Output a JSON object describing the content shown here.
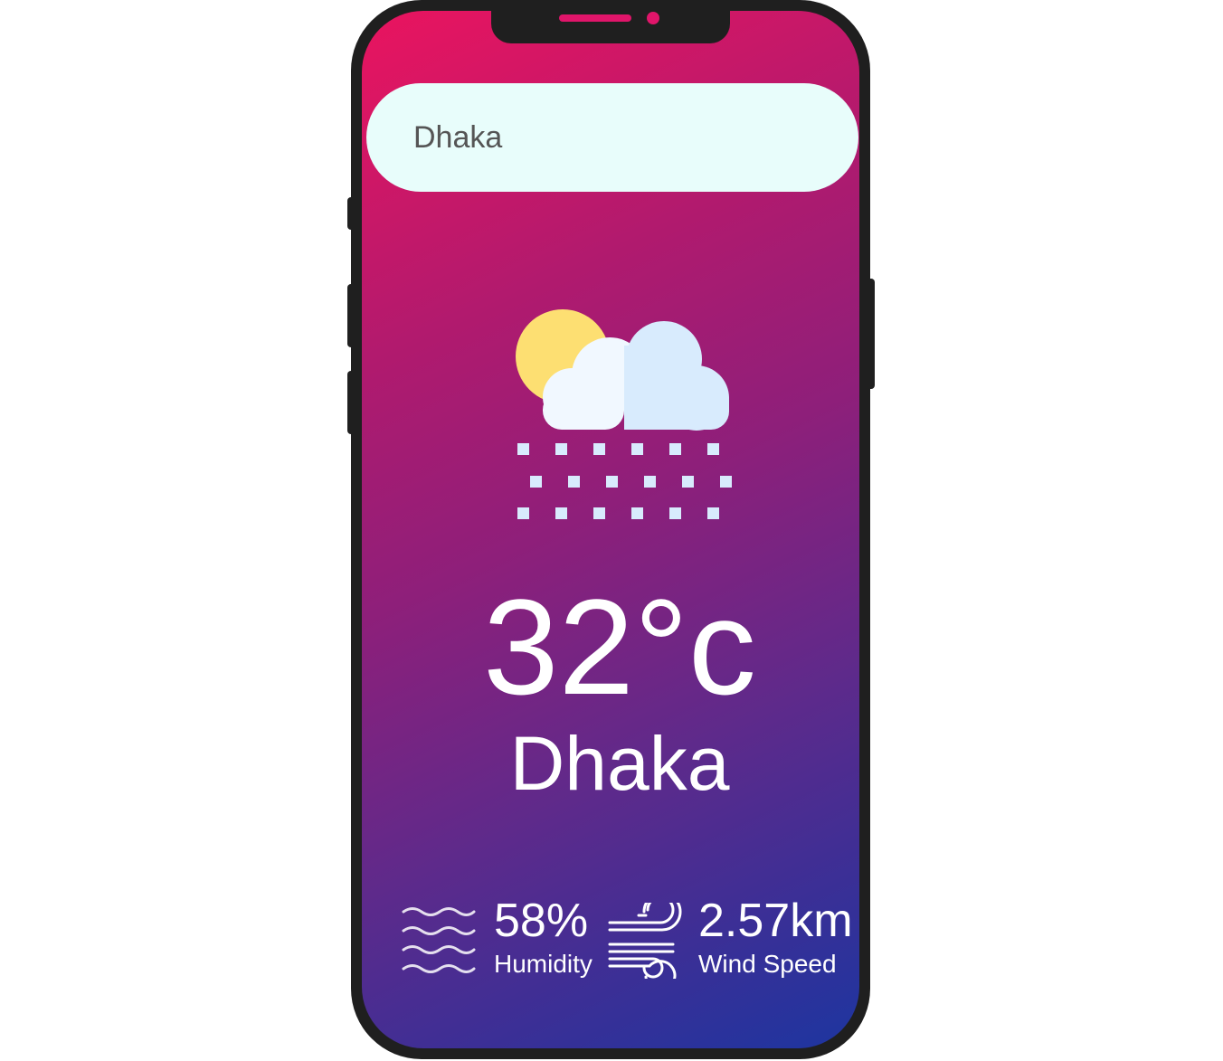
{
  "search": {
    "value": "Dhaka"
  },
  "weather": {
    "icon": "sun-cloud-snow-icon",
    "temperature": "32°c",
    "city": "Dhaka"
  },
  "humidity": {
    "icon": "humidity-waves-icon",
    "value": "58%",
    "label": "Humidity"
  },
  "wind": {
    "icon": "wind-icon",
    "value": "2.57km",
    "label": "Wind Speed"
  },
  "colors": {
    "gradient_start": "#ea145f",
    "gradient_end": "#1d35a0",
    "search_bg": "#e8fdfb",
    "phone_frame": "#1f1f1f",
    "sun": "#fddf72",
    "cloud_light": "#f1f8ff",
    "cloud_shade": "#d8ebfd"
  }
}
